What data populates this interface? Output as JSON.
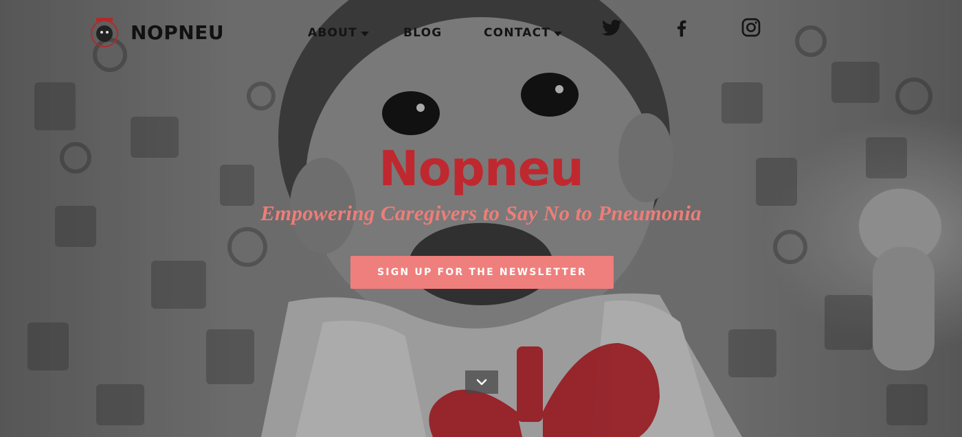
{
  "brand": {
    "name": "NOPNEU",
    "logo_icon": "baby-face-logo-icon"
  },
  "nav": {
    "items": [
      {
        "label": "ABOUT",
        "has_dropdown": true
      },
      {
        "label": "BLOG",
        "has_dropdown": false
      },
      {
        "label": "CONTACT",
        "has_dropdown": true
      }
    ],
    "social": [
      {
        "icon": "twitter-icon"
      },
      {
        "icon": "facebook-icon"
      },
      {
        "icon": "instagram-icon"
      }
    ]
  },
  "hero": {
    "title": "Nopneu",
    "subtitle": "Empowering Caregivers to Say No to Pneumonia",
    "cta_label": "SIGN UP FOR THE NEWSLETTER",
    "scroll_icon": "chevron-down-icon"
  },
  "colors": {
    "title": "#c0282f",
    "subtitle": "#ee7d78",
    "cta_bg": "#ef7f7c",
    "lungs": "#c0202a",
    "nav_text": "#141414"
  }
}
